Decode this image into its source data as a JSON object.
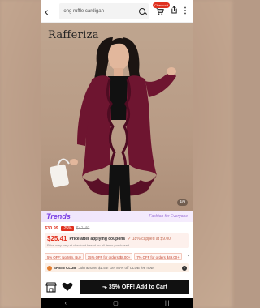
{
  "search": {
    "query": "long ruffle cardigan",
    "cart_badge": "Checkout"
  },
  "hero": {
    "brand": "Rafferiza",
    "counter": "4/9"
  },
  "trends": {
    "logo": "Trends",
    "tagline": "Fashion for Everyone"
  },
  "price": {
    "current": "$30.99",
    "discount": "-25%",
    "original": "$41.49"
  },
  "coupon": {
    "price": "$25.41",
    "label": "Price after applying coupons",
    "capped": "✓ 18% capped at $9.00",
    "note": "Price may vary at checkout based on all items purchased"
  },
  "promos": [
    "5% OFF: No Min. Buy",
    "15% OFF for orders $8.00+",
    "7% OFF for orders $49.00+"
  ],
  "club": {
    "name": "SHEIN CLUB",
    "text": "Join & save $1.55! Get 80% off CLUB fee now"
  },
  "actions": {
    "add_to_cart": "⬎ 35% OFF! Add to Cart"
  },
  "colors": {
    "accent": "#e0301e",
    "trends": "#7b3fe4",
    "garment": "#6e1530"
  }
}
